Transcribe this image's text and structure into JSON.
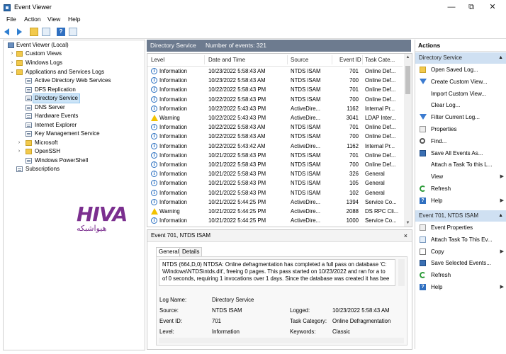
{
  "window": {
    "title": "Event Viewer",
    "controls": [
      "—",
      "⧉",
      "✕"
    ]
  },
  "menubar": [
    "File",
    "Action",
    "View",
    "Help"
  ],
  "tree": [
    {
      "label": "Event Viewer (Local)",
      "icon": "computer-icon",
      "expander": ""
    },
    {
      "label": "Custom Views",
      "icon": "folder-icon",
      "expander": "›"
    },
    {
      "label": "Windows Logs",
      "icon": "folder-icon",
      "expander": "›"
    },
    {
      "label": "Applications and Services Logs",
      "icon": "folder-icon",
      "expander": "⌄"
    },
    {
      "label": "Active Directory Web Services",
      "icon": "log-icon",
      "expander": ""
    },
    {
      "label": "DFS Replication",
      "icon": "log-icon",
      "expander": ""
    },
    {
      "label": "Directory Service",
      "icon": "log-icon",
      "expander": "",
      "selected": true
    },
    {
      "label": "DNS Server",
      "icon": "log-icon",
      "expander": ""
    },
    {
      "label": "Hardware Events",
      "icon": "log-icon",
      "expander": ""
    },
    {
      "label": "Internet Explorer",
      "icon": "log-icon",
      "expander": ""
    },
    {
      "label": "Key Management Service",
      "icon": "log-icon",
      "expander": ""
    },
    {
      "label": "Microsoft",
      "icon": "folder-icon",
      "expander": "›"
    },
    {
      "label": "OpenSSH",
      "icon": "folder-icon",
      "expander": "›"
    },
    {
      "label": "Windows PowerShell",
      "icon": "log-icon",
      "expander": ""
    },
    {
      "label": "Subscriptions",
      "icon": "log-icon",
      "expander": ""
    }
  ],
  "center": {
    "log_name": "Directory Service",
    "event_count": "Number of events: 321",
    "columns": [
      "Level",
      "Date and Time",
      "Source",
      "Event ID",
      "Task Cate..."
    ],
    "rows": [
      {
        "level": "Information",
        "date": "10/23/2022 5:58:43 AM",
        "source": "NTDS ISAM",
        "id": "701",
        "task": "Online Def..."
      },
      {
        "level": "Information",
        "date": "10/23/2022 5:58:43 AM",
        "source": "NTDS ISAM",
        "id": "700",
        "task": "Online Def..."
      },
      {
        "level": "Information",
        "date": "10/22/2022 5:58:43 PM",
        "source": "NTDS ISAM",
        "id": "701",
        "task": "Online Def..."
      },
      {
        "level": "Information",
        "date": "10/22/2022 5:58:43 PM",
        "source": "NTDS ISAM",
        "id": "700",
        "task": "Online Def..."
      },
      {
        "level": "Information",
        "date": "10/22/2022 5:43:43 PM",
        "source": "ActiveDire...",
        "id": "1162",
        "task": "Internal Pr..."
      },
      {
        "level": "Warning",
        "date": "10/22/2022 5:43:43 PM",
        "source": "ActiveDire...",
        "id": "3041",
        "task": "LDAP Inter..."
      },
      {
        "level": "Information",
        "date": "10/22/2022 5:58:43 AM",
        "source": "NTDS ISAM",
        "id": "701",
        "task": "Online Def..."
      },
      {
        "level": "Information",
        "date": "10/22/2022 5:58:43 AM",
        "source": "NTDS ISAM",
        "id": "700",
        "task": "Online Def..."
      },
      {
        "level": "Information",
        "date": "10/22/2022 5:43:42 AM",
        "source": "ActiveDire...",
        "id": "1162",
        "task": "Internal Pr..."
      },
      {
        "level": "Information",
        "date": "10/21/2022 5:58:43 PM",
        "source": "NTDS ISAM",
        "id": "701",
        "task": "Online Def..."
      },
      {
        "level": "Information",
        "date": "10/21/2022 5:58:43 PM",
        "source": "NTDS ISAM",
        "id": "700",
        "task": "Online Def..."
      },
      {
        "level": "Information",
        "date": "10/21/2022 5:58:43 PM",
        "source": "NTDS ISAM",
        "id": "326",
        "task": "General"
      },
      {
        "level": "Information",
        "date": "10/21/2022 5:58:43 PM",
        "source": "NTDS ISAM",
        "id": "105",
        "task": "General"
      },
      {
        "level": "Information",
        "date": "10/21/2022 5:58:43 PM",
        "source": "NTDS ISAM",
        "id": "102",
        "task": "General"
      },
      {
        "level": "Information",
        "date": "10/21/2022 5:44:25 PM",
        "source": "ActiveDire...",
        "id": "1394",
        "task": "Service Co..."
      },
      {
        "level": "Warning",
        "date": "10/21/2022 5:44:25 PM",
        "source": "ActiveDire...",
        "id": "2088",
        "task": "DS RPC Cli..."
      },
      {
        "level": "Information",
        "date": "10/21/2022 5:44:25 PM",
        "source": "ActiveDire...",
        "id": "1000",
        "task": "Service Co..."
      }
    ]
  },
  "detail": {
    "title": "Event 701, NTDS ISAM",
    "close": "×",
    "tabs": [
      "General",
      "Details"
    ],
    "message": [
      "NTDS (664,D,0) NTDSA: Online defragmentation has completed a full pass on database 'C:",
      "\\Windows\\NTDS\\ntds.dit', freeing 0 pages. This pass started on 10/23/2022 and ran for a to",
      "of 0 seconds, requiring 1 invocations over 1 days. Since the database was created it has bee"
    ],
    "props": {
      "log_name_label": "Log Name:",
      "log_name": "Directory Service",
      "source_label": "Source:",
      "source": "NTDS ISAM",
      "logged_label": "Logged:",
      "logged": "10/23/2022 5:58:43 AM",
      "event_id_label": "Event ID:",
      "event_id": "701",
      "task_label": "Task Category:",
      "task": "Online Defragmentation",
      "level_label": "Level:",
      "level": "Information",
      "keywords_label": "Keywords:",
      "keywords": "Classic"
    }
  },
  "actions": {
    "title": "Actions",
    "section1": "Directory Service",
    "items1": [
      {
        "label": "Open Saved Log...",
        "icon": "open-icon"
      },
      {
        "label": "Create Custom View...",
        "icon": "filter-icon"
      },
      {
        "label": "Import Custom View...",
        "icon": ""
      },
      {
        "label": "Clear Log...",
        "icon": ""
      },
      {
        "label": "Filter Current Log...",
        "icon": "filter-icon"
      },
      {
        "label": "Properties",
        "icon": "properties-icon"
      },
      {
        "label": "Find...",
        "icon": "find-icon"
      },
      {
        "label": "Save All Events As...",
        "icon": "save-icon"
      },
      {
        "label": "Attach a Task To this L...",
        "icon": ""
      },
      {
        "label": "View",
        "icon": "",
        "submenu": true
      },
      {
        "label": "Refresh",
        "icon": "refresh-icon"
      },
      {
        "label": "Help",
        "icon": "help-icon",
        "submenu": true
      }
    ],
    "section2": "Event 701, NTDS ISAM",
    "items2": [
      {
        "label": "Event Properties",
        "icon": "properties-icon"
      },
      {
        "label": "Attach Task To This Ev...",
        "icon": "attach-icon"
      },
      {
        "label": "Copy",
        "icon": "copy-icon",
        "submenu": true
      },
      {
        "label": "Save Selected Events...",
        "icon": "save-icon"
      },
      {
        "label": "Refresh",
        "icon": "refresh-icon"
      },
      {
        "label": "Help",
        "icon": "help-icon",
        "submenu": true
      }
    ]
  },
  "watermark": {
    "logo": "HIVA",
    "subtitle": "هیواشبکه"
  },
  "colors": {
    "header_bg": "#6d7b8f",
    "section_bg": "#cfe0f2",
    "selected_bg": "#cce4f7",
    "info_icon": "#2a6fc0",
    "warning_icon": "#f2c200",
    "watermark": "#7b2f8f"
  }
}
